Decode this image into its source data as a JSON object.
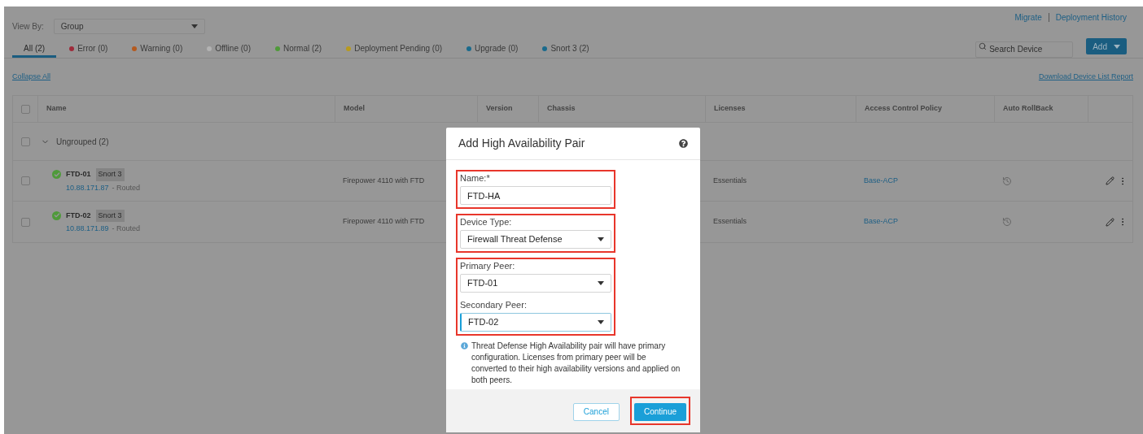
{
  "view_by": {
    "label": "View By:",
    "value": "Group"
  },
  "header_links": [
    "Migrate",
    "Deployment History"
  ],
  "filter_tabs": [
    {
      "label": "All (2)",
      "selected": true
    },
    {
      "label": "Error (0)",
      "selected": false,
      "color": "#9e2a3a"
    },
    {
      "label": "Warning (0)",
      "selected": false,
      "color": "#b45a1f"
    },
    {
      "label": "Offline (0)",
      "selected": false,
      "color": "#b3b3b3"
    },
    {
      "label": "Normal (2)",
      "selected": false,
      "color": "#4f9a3a"
    },
    {
      "label": "Deployment Pending (0)",
      "selected": false,
      "color": "#b89a1e"
    },
    {
      "label": "Upgrade (0)",
      "selected": false,
      "color": "#1a6a8c"
    },
    {
      "label": "Snort 3 (2)",
      "selected": false,
      "color": "#1a6a8c"
    }
  ],
  "search": {
    "placeholder": "Search Device"
  },
  "add_button": "Add",
  "collapse_all": "Collapse All",
  "download_link": "Download Device List Report",
  "table": {
    "columns": [
      "Name",
      "Model",
      "Version",
      "Chassis",
      "Licenses",
      "Access Control Policy",
      "Auto RollBack"
    ],
    "all_checked": false,
    "group": {
      "label": "Ungrouped (2)",
      "expanded": true,
      "checked": false
    },
    "rows": [
      {
        "name": "FTD-01",
        "tag": "Snort 3",
        "ip": "10.88.171.87",
        "mode": "- Routed",
        "kind": "normal",
        "model": "Firepower 4110 with FTD",
        "licenses": "Essentials",
        "policy": "Base-ACP",
        "checked": false
      },
      {
        "name": "FTD-02",
        "tag": "Snort 3",
        "ip": "10.88.171.89",
        "mode": "- Routed",
        "kind": "normal",
        "model": "Firepower 4110 with FTD",
        "licenses": "Essentials",
        "policy": "Base-ACP",
        "checked": false
      }
    ]
  },
  "dialog": {
    "title": "Add High Availability Pair",
    "sections": [
      {
        "highlighted": true,
        "fields": [
          {
            "kind": "text",
            "label": "Name:*",
            "value": "FTD-HA",
            "focused": false
          }
        ]
      },
      {
        "highlighted": true,
        "fields": [
          {
            "kind": "select",
            "label": "Device Type:",
            "value": "Firewall Threat Defense",
            "focused": false
          }
        ]
      },
      {
        "highlighted": true,
        "fields": [
          {
            "kind": "select",
            "label": "Primary Peer:",
            "value": "FTD-01",
            "focused": false
          },
          {
            "kind": "select",
            "label": "Secondary Peer:",
            "value": "FTD-02",
            "focused": true
          }
        ]
      }
    ],
    "info": "Threat Defense High Availability pair will have primary configuration. Licenses from primary peer will be converted to their high availability versions and applied on both peers.",
    "buttons": [
      {
        "label": "Cancel",
        "kind": "secondary",
        "highlighted": false
      },
      {
        "label": "Continue",
        "kind": "primary",
        "highlighted": true
      }
    ]
  }
}
